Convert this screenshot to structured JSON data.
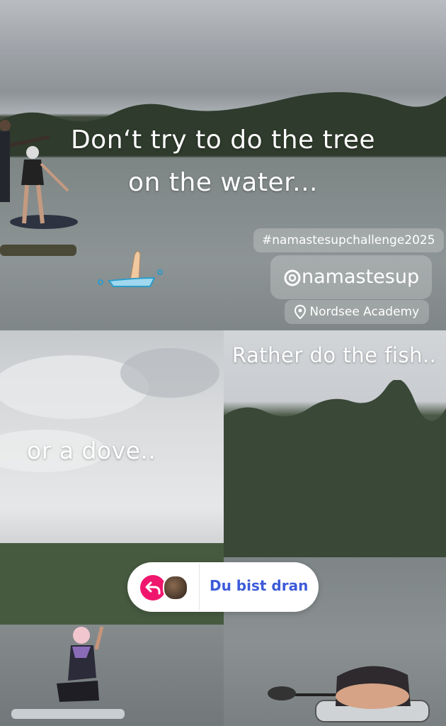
{
  "story": {
    "caption_top": "Don‘t try to do the tree on the water...",
    "caption_top_line1": "Don‘t try to do the tree",
    "caption_top_line2": "on the water...",
    "caption_right": "Rather do the fish..",
    "caption_left": "or a dove..",
    "hashtag": "#namastesupchallenge2025",
    "mention": "@namastesup",
    "mention_handle": "namastesup",
    "location": "Nordsee Academy"
  },
  "reply": {
    "label": "Du bist dran",
    "accent_color": "#f0166e",
    "label_color": "#3d5bd9"
  },
  "icons": [
    "threads-icon",
    "location-pin-icon",
    "reply-arrow-icon",
    "drowning-hand-sticker"
  ]
}
